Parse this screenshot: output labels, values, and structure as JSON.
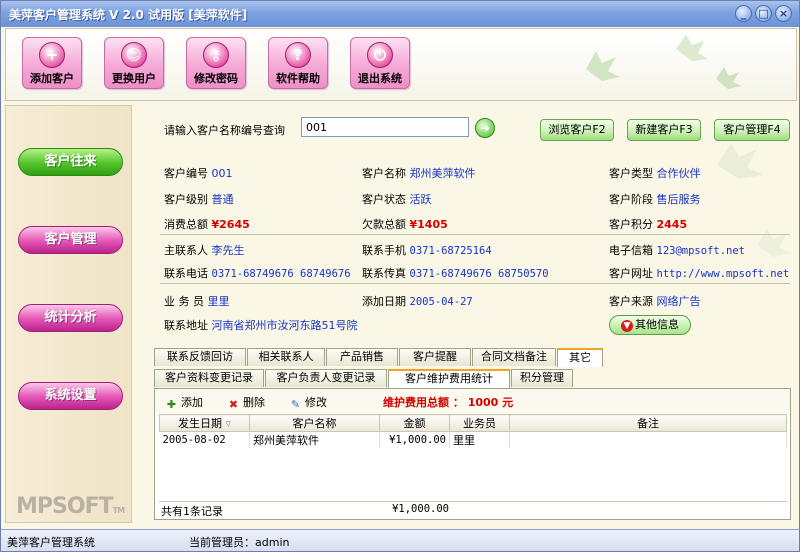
{
  "window": {
    "title": "美萍客户管理系统 V 2.0 试用版 [美萍软件]",
    "controls": [
      "_",
      "□",
      "×"
    ]
  },
  "toolbar": {
    "buttons": [
      {
        "label": "添加客户",
        "icon": "add-customer-icon"
      },
      {
        "label": "更换用户",
        "icon": "switch-user-icon"
      },
      {
        "label": "修改密码",
        "icon": "key-icon"
      },
      {
        "label": "软件帮助",
        "icon": "help-icon"
      },
      {
        "label": "退出系统",
        "icon": "exit-icon"
      }
    ]
  },
  "sidebar": {
    "items": [
      {
        "label": "客户往来",
        "color": "green"
      },
      {
        "label": "客户管理",
        "color": "pink"
      },
      {
        "label": "统计分析",
        "color": "pink"
      },
      {
        "label": "系统设置",
        "color": "pink"
      }
    ],
    "logo": "MPSOFT",
    "logo_tm": "TM"
  },
  "search": {
    "label": "请输入客户名称编号查询",
    "value": "001",
    "browse_label": "浏览客户F2",
    "new_label": "新建客户F3",
    "manage_label": "客户管理F4"
  },
  "customer": {
    "id_label": "客户编号",
    "id": "001",
    "name_label": "客户名称",
    "name": "郑州美萍软件",
    "type_label": "客户类型",
    "type": "合作伙伴",
    "level_label": "客户级别",
    "level": "普通",
    "status_label": "客户状态",
    "status": "活跃",
    "stage_label": "客户阶段",
    "stage": "售后服务",
    "spent_label": "消费总额",
    "spent": "¥2645",
    "owed_label": "欠款总额",
    "owed": "¥1405",
    "points_label": "客户积分",
    "points": "2445",
    "contact_label": "主联系人",
    "contact": "李先生",
    "mobile_label": "联系手机",
    "mobile": "0371-68725164",
    "email_label": "电子信箱",
    "email": "123@mpsoft.net",
    "phone_label": "联系电话",
    "phone": "0371-68749676 68749676",
    "fax_label": "联系传真",
    "fax": "0371-68749676 68750570",
    "website_label": "客户网址",
    "website": "http://www.mpsoft.net",
    "salesman_label": "业 务 员",
    "salesman": "里里",
    "added_label": "添加日期",
    "added": "2005-04-27",
    "source_label": "客户来源",
    "source": "网络广告",
    "address_label": "联系地址",
    "address": "河南省郑州市汝河东路51号院",
    "other_info_label": "其他信息"
  },
  "tabs": {
    "main": [
      "联系反馈回访",
      "相关联系人",
      "产品销售",
      "客户提醒",
      "合同文档备注",
      "其它"
    ],
    "sub": [
      "客户资料变更记录",
      "客户负责人变更记录",
      "客户维护费用统计",
      "积分管理"
    ]
  },
  "actions": {
    "add": "添加",
    "delete": "删除",
    "edit": "修改",
    "total_label": "维护费用总额 ：",
    "total_value": "1000",
    "total_unit": "元"
  },
  "grid": {
    "columns": [
      "发生日期",
      "客户名称",
      "金额",
      "业务员",
      "备注"
    ],
    "rows": [
      {
        "date": "2005-08-02",
        "customer": "郑州美萍软件",
        "amount": "¥1,000.00",
        "salesman": "里里",
        "note": ""
      }
    ],
    "record_count": "共有1条记录",
    "sum_amount": "¥1,000.00"
  },
  "statusbar": {
    "app": "美萍客户管理系统",
    "admin": "当前管理员：admin"
  }
}
